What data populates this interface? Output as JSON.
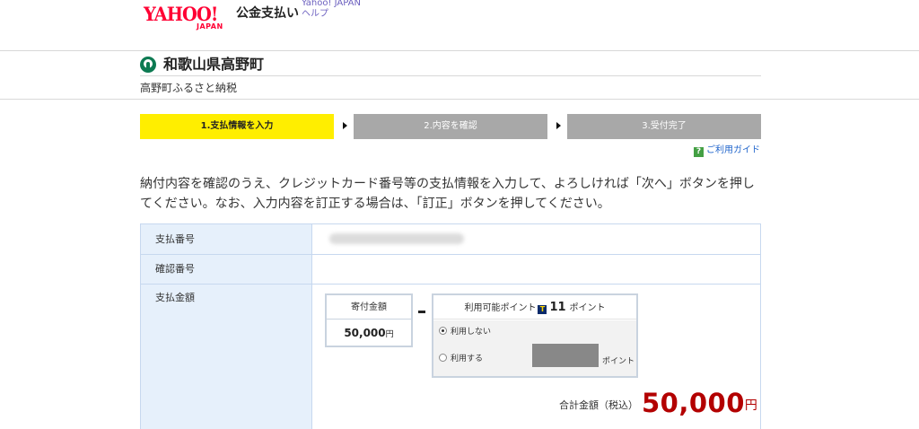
{
  "header": {
    "logo_text": "YAHOO!",
    "logo_sub": "JAPAN",
    "service_name": "公金支払い",
    "link_yahoo": "Yahoo! JAPAN",
    "link_help": "ヘルプ"
  },
  "merchant": {
    "name": "和歌山県高野町",
    "sub": "高野町ふるさと納税"
  },
  "steps": [
    {
      "label": "1.支払情報を入力",
      "active": true
    },
    {
      "label": "2.内容を確認",
      "active": false
    },
    {
      "label": "3.受付完了",
      "active": false
    }
  ],
  "guide": {
    "icon": "?",
    "label": "ご利用ガイド"
  },
  "instructions": "納付内容を確認のうえ、クレジットカード番号等の支払情報を入力して、よろしければ「次へ」ボタンを押してください。なお、入力内容を訂正する場合は、「訂正」ボタンを押してください。",
  "form": {
    "payment_number_label": "支払番号",
    "confirmation_number_label": "確認番号",
    "amount_label": "支払金額"
  },
  "donation": {
    "label": "寄付金額",
    "value": "50,000",
    "unit": "円"
  },
  "points": {
    "label_prefix": "利用可能ポイント",
    "icon": "T",
    "value": "11",
    "label_suffix": "ポイント",
    "option_no": "利用しない",
    "option_yes": "利用する",
    "unit": "ポイント",
    "selected": "no"
  },
  "total": {
    "label": "合計金額（税込）",
    "value": "50,000",
    "unit": "円"
  },
  "colors": {
    "active_step": "#ffee00",
    "inactive_step": "#a8a8a8",
    "total": "#b30000",
    "label_bg": "#e6f0fb",
    "brand": "#ff0033"
  }
}
